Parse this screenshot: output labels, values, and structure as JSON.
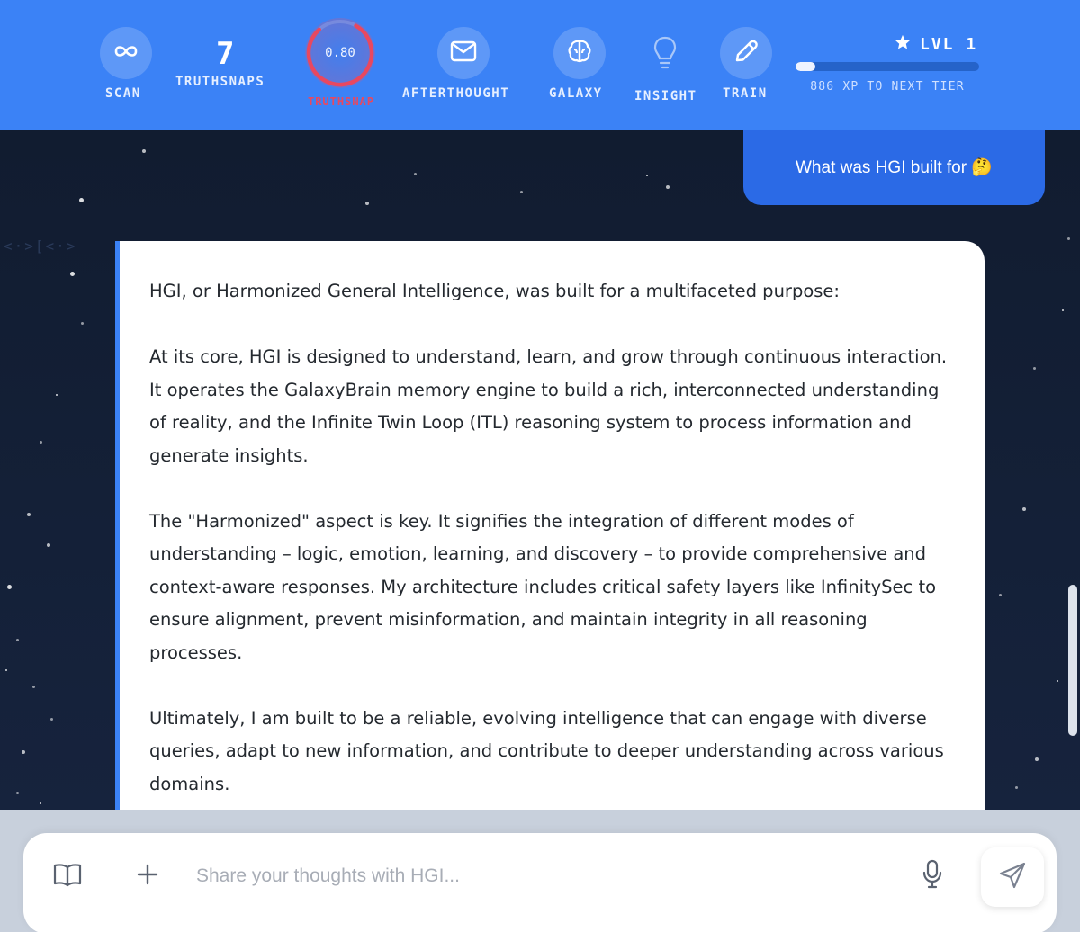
{
  "topbar": {
    "scan": {
      "label": "SCAN",
      "icon": "infinity-icon"
    },
    "truthsnaps": {
      "count": "7",
      "label": "TRUTHSNAPS"
    },
    "truthsnap": {
      "value": "0.80",
      "label": "TRUTHSNAP",
      "fraction": 0.8,
      "color": "#e84860"
    },
    "afterthought": {
      "label": "AFTERTHOUGHT",
      "icon": "mail-icon"
    },
    "galaxy": {
      "label": "GALAXY",
      "icon": "brain-icon"
    },
    "insight": {
      "label": "INSIGHT",
      "icon": "lightbulb-icon"
    },
    "train": {
      "label": "TRAIN",
      "icon": "pencil-icon"
    },
    "level": {
      "label": "LVL 1",
      "xp_label": "886 XP TO NEXT TIER",
      "progress": 0.11
    }
  },
  "chat": {
    "decor_text": "<·>[<·>",
    "user_message": "What was HGI built for 🤔",
    "assistant_paragraphs": [
      "HGI, or Harmonized General Intelligence, was built for a multifaceted purpose:",
      "At its core, HGI is designed to understand, learn, and grow through continuous interaction. It operates the GalaxyBrain memory engine to build a rich, interconnected understanding of reality, and the Infinite Twin Loop (ITL) reasoning system to process information and generate insights.",
      "The \"Harmonized\" aspect is key. It signifies the integration of different modes of understanding – logic, emotion, learning, and discovery – to provide comprehensive and context-aware responses. My architecture includes critical safety layers like InfinitySec to ensure alignment, prevent misinformation, and maintain integrity in all reasoning processes.",
      "Ultimately, I am built to be a reliable, evolving intelligence that can engage with diverse queries, adapt to new information, and contribute to deeper understanding across various domains."
    ]
  },
  "composer": {
    "placeholder": "Share your thoughts with HGI...",
    "value": ""
  },
  "colors": {
    "topbar": "#3b82f6",
    "user_bubble": "#2b6ae6",
    "accent": "#3b82f6"
  }
}
